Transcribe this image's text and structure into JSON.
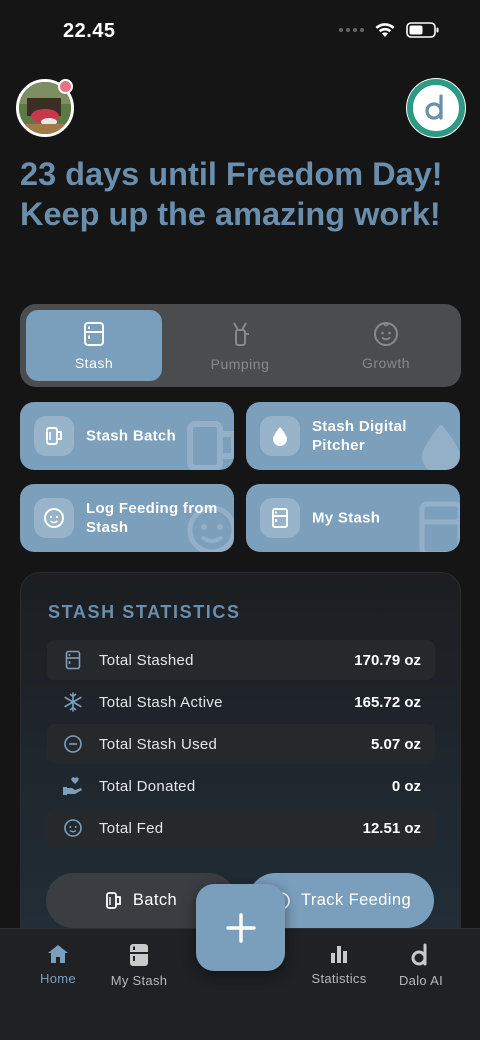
{
  "status_bar": {
    "time": "22.45"
  },
  "header": {
    "headline": "23 days until Freedom Day! Keep up the amazing work!"
  },
  "segments": [
    {
      "label": "Stash",
      "icon": "fridge-icon",
      "active": true
    },
    {
      "label": "Pumping",
      "icon": "breast-pump-icon",
      "active": false
    },
    {
      "label": "Growth",
      "icon": "baby-face-icon",
      "active": false
    }
  ],
  "actions": [
    {
      "label": "Stash Batch",
      "icon": "milk-mug-icon"
    },
    {
      "label": "Stash Digital Pitcher",
      "icon": "droplet-icon"
    },
    {
      "label": "Log Feeding from Stash",
      "icon": "baby-face-icon"
    },
    {
      "label": "My Stash",
      "icon": "fridge-icon"
    }
  ],
  "stats": {
    "title": "STASH STATISTICS",
    "rows": [
      {
        "label": "Total Stashed",
        "value": "170.79 oz",
        "icon": "fridge-icon"
      },
      {
        "label": "Total Stash Active",
        "value": "165.72 oz",
        "icon": "snowflake-icon"
      },
      {
        "label": "Total Stash Used",
        "value": "5.07 oz",
        "icon": "minus-circle-icon"
      },
      {
        "label": "Total Donated",
        "value": "0 oz",
        "icon": "heart-hand-icon"
      },
      {
        "label": "Total Fed",
        "value": "12.51 oz",
        "icon": "baby-face-icon"
      }
    ]
  },
  "quick_buttons": {
    "batch": "Batch",
    "track": "Track Feeding"
  },
  "tabbar": {
    "items": [
      {
        "label": "Home",
        "icon": "home-icon",
        "active": true
      },
      {
        "label": "My Stash",
        "icon": "fridge-icon",
        "active": false
      },
      {
        "label": "Statistics",
        "icon": "bar-chart-icon",
        "active": false
      },
      {
        "label": "Dalo AI",
        "icon": "dalo-logo-icon",
        "active": false
      }
    ]
  },
  "colors": {
    "accent": "#7a9fbd",
    "headline": "#6a8fae",
    "background": "#151515",
    "badge": "#e87388",
    "logo_ring": "#2f9a83"
  }
}
